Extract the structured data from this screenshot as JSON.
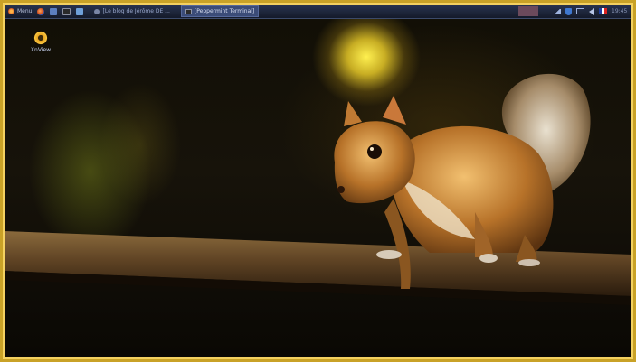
{
  "taskbar": {
    "menu_label": "Menu",
    "tasks": [
      {
        "label": "[Le blog de Jérôme DE ..."
      },
      {
        "label": "[Peppermint Terminal]"
      }
    ],
    "clock": "19:45"
  },
  "desktop": {
    "icons": [
      {
        "label": "XnView"
      }
    ],
    "wallpaper": "squirrel-on-wooden-rail"
  }
}
